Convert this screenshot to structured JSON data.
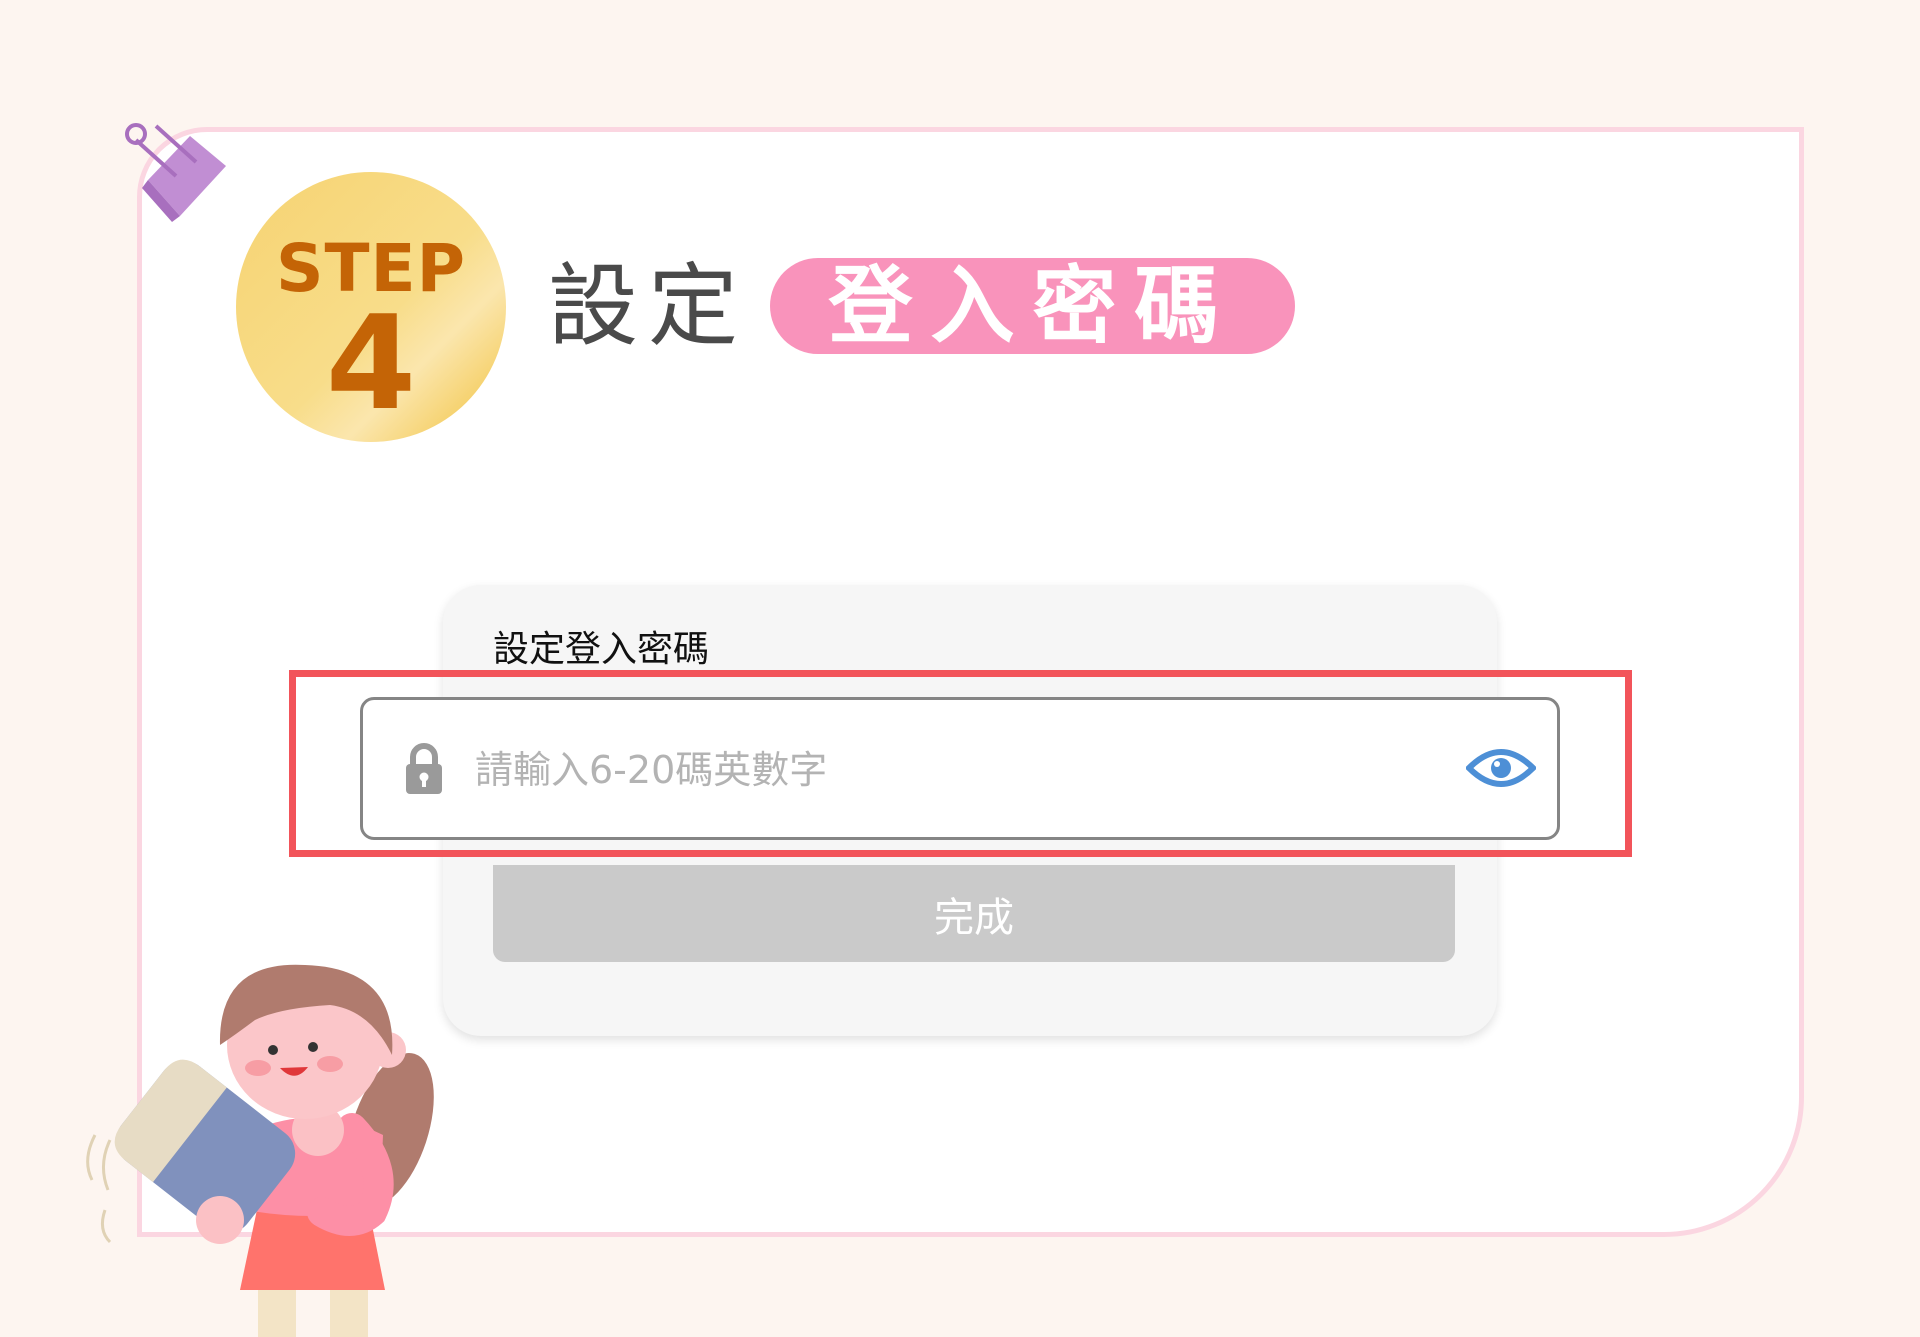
{
  "step": {
    "label": "STEP",
    "number": "4"
  },
  "heading": {
    "prefix": "設定",
    "highlight": "登入密碼"
  },
  "form": {
    "label": "設定登入密碼",
    "password_placeholder": "請輸入6-20碼英數字",
    "submit_label": "完成"
  },
  "colors": {
    "background": "#fdf5f0",
    "card_border": "#fbd6e1",
    "step_badge": "#f6d372",
    "step_text": "#c46406",
    "highlight_pill": "#f993bb",
    "focus_box": "#f2545a",
    "eye_icon": "#4d8fd6",
    "button_disabled": "#cacaca"
  },
  "icons": [
    "binder-clip-icon",
    "lock-icon",
    "eye-icon",
    "girl-illustration"
  ]
}
